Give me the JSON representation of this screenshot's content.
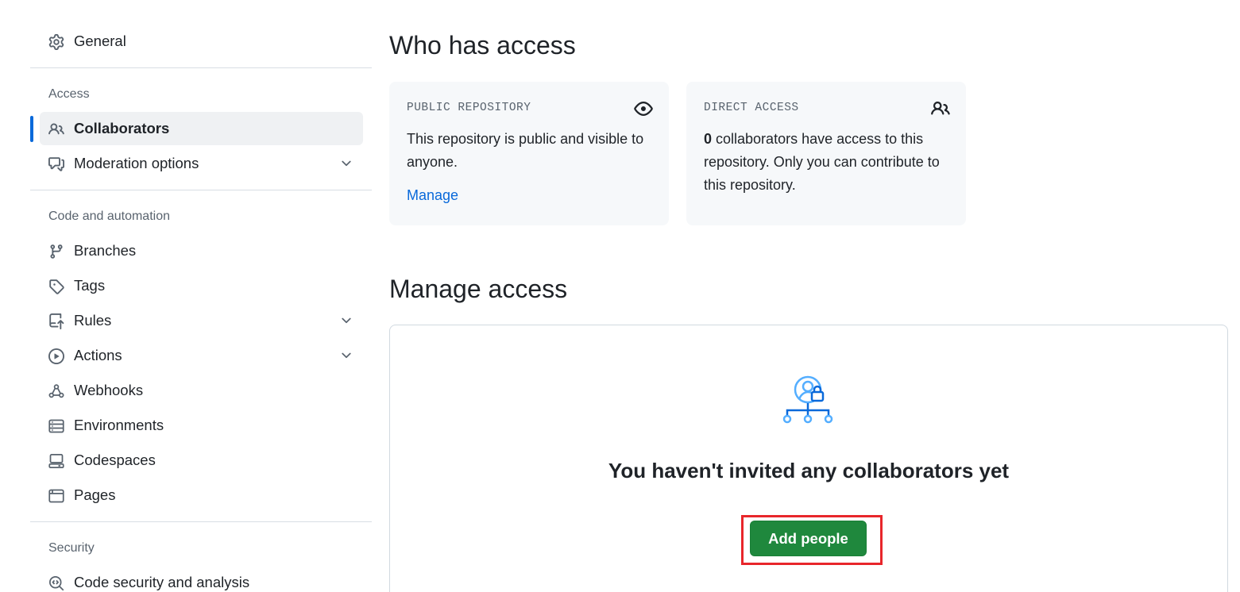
{
  "sidebar": {
    "general": "General",
    "access_section": "Access",
    "access_items": [
      {
        "label": "Collaborators",
        "icon": "people-icon",
        "active": true
      },
      {
        "label": "Moderation options",
        "icon": "comment-discussion-icon",
        "expandable": true
      }
    ],
    "code_section": "Code and automation",
    "code_items": [
      {
        "label": "Branches",
        "icon": "git-branch-icon"
      },
      {
        "label": "Tags",
        "icon": "tag-icon"
      },
      {
        "label": "Rules",
        "icon": "repo-push-icon",
        "expandable": true
      },
      {
        "label": "Actions",
        "icon": "play-icon",
        "expandable": true
      },
      {
        "label": "Webhooks",
        "icon": "webhook-icon"
      },
      {
        "label": "Environments",
        "icon": "server-icon"
      },
      {
        "label": "Codespaces",
        "icon": "codespaces-icon"
      },
      {
        "label": "Pages",
        "icon": "browser-icon"
      }
    ],
    "security_section": "Security",
    "security_items": [
      {
        "label": "Code security and analysis",
        "icon": "codescan-icon"
      }
    ]
  },
  "who_has_access": {
    "heading": "Who has access",
    "public_card": {
      "title": "PUBLIC REPOSITORY",
      "text": "This repository is public and visible to anyone.",
      "link": "Manage"
    },
    "direct_card": {
      "title": "DIRECT ACCESS",
      "count": "0",
      "text": " collaborators have access to this repository. Only you can contribute to this repository."
    }
  },
  "manage_access": {
    "heading": "Manage access",
    "empty_title": "You haven't invited any collaborators yet",
    "add_button": "Add people"
  },
  "colors": {
    "accent": "#0969da",
    "primary_button": "#1f883d",
    "highlight_border": "#e8262b"
  }
}
